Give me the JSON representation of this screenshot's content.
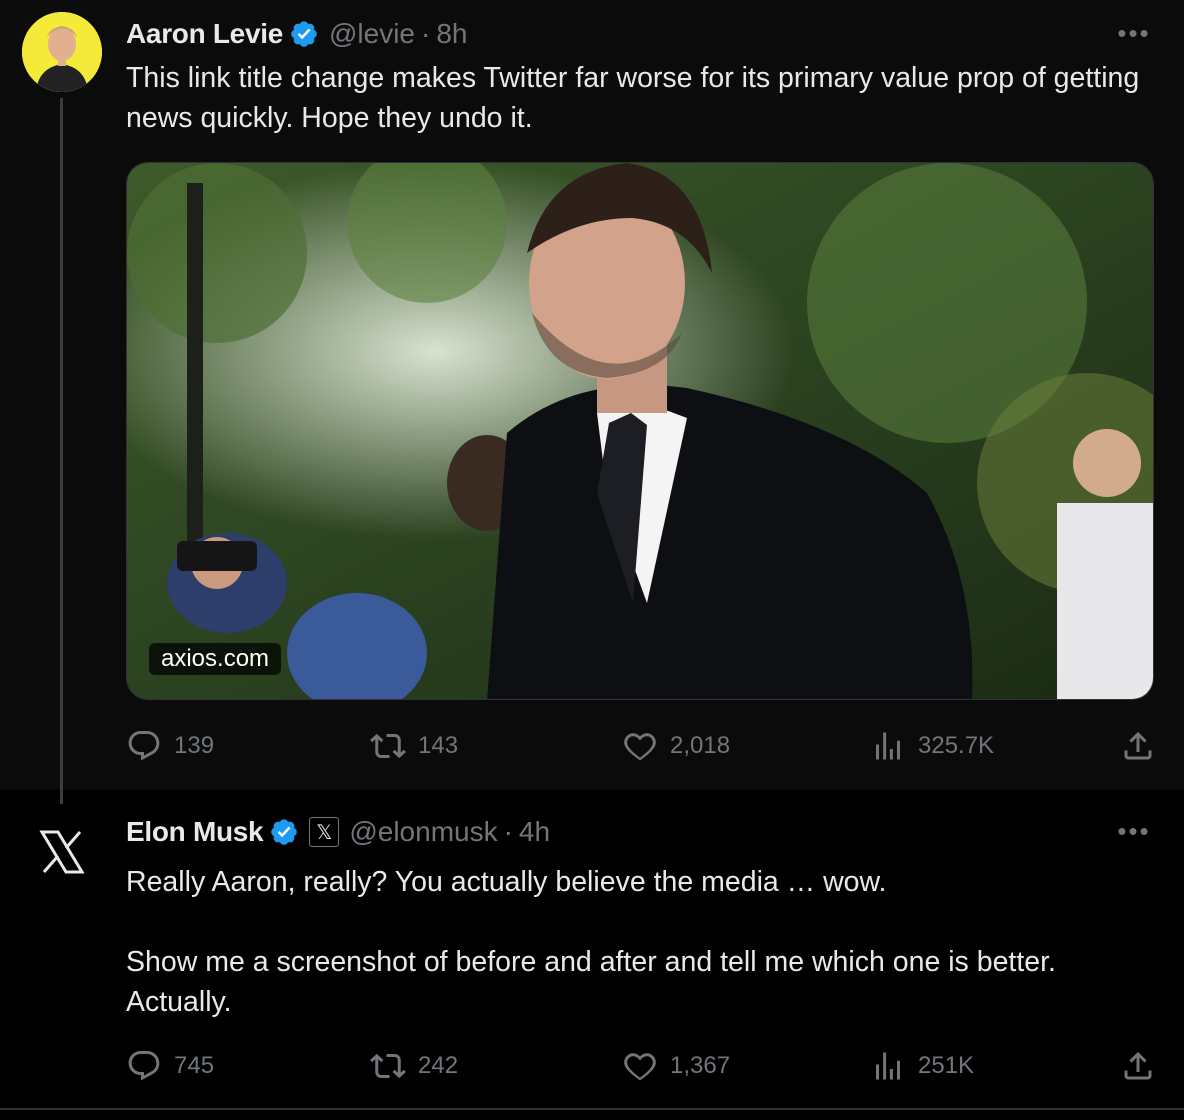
{
  "tweets": [
    {
      "author_name": "Aaron Levie",
      "handle": "@levie",
      "separator": "·",
      "time": "8h",
      "text": "This link title change makes Twitter far worse for its primary value prop of getting news quickly. Hope they undo it.",
      "link_card": {
        "domain": "axios.com"
      },
      "stats": {
        "replies": "139",
        "retweets": "143",
        "likes": "2,018",
        "views": "325.7K"
      }
    },
    {
      "author_name": "Elon Musk",
      "handle": "@elonmusk",
      "separator": "·",
      "time": "4h",
      "affiliation_badge": "𝕏",
      "text": "Really Aaron, really? You actually believe the media … wow.\n\nShow me a screenshot of before and after and tell me which one is better. Actually.",
      "stats": {
        "replies": "745",
        "retweets": "242",
        "likes": "1,367",
        "views": "251K"
      }
    }
  ],
  "more_label": "•••",
  "colors": {
    "verified": "#1d9bf0",
    "muted": "#71767b",
    "text": "#e7e9ea",
    "avatar_bg": "#f3ea3a"
  },
  "icons": [
    "verified-badge-icon",
    "more-icon",
    "reply-icon",
    "retweet-icon",
    "like-icon",
    "views-icon",
    "share-icon",
    "x-logo-icon"
  ]
}
